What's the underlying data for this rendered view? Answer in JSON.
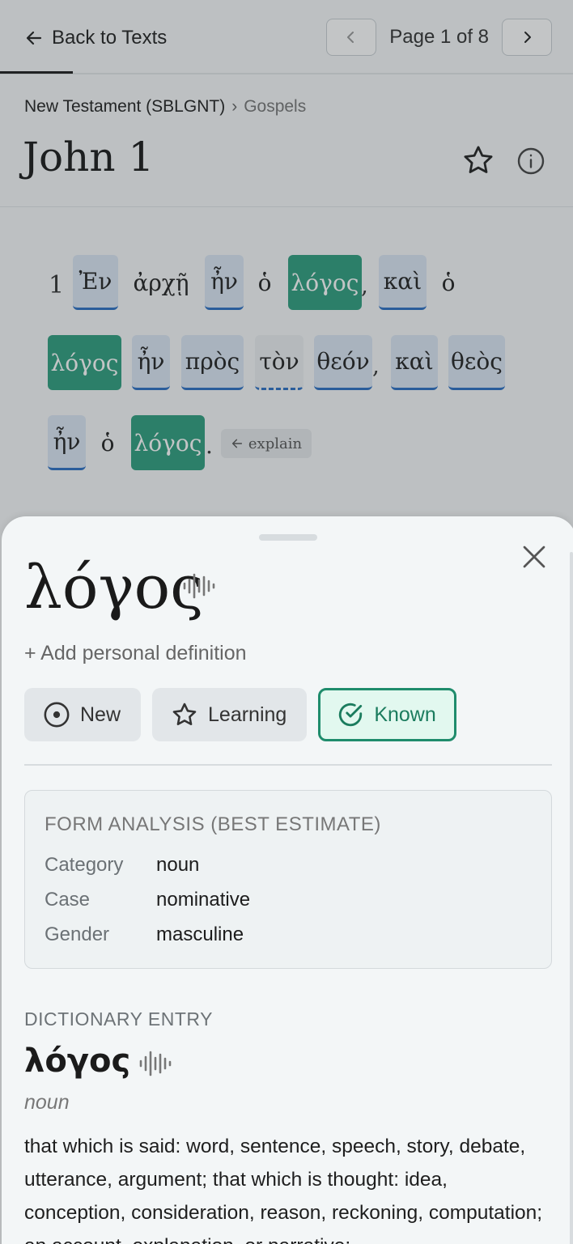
{
  "nav": {
    "back_label": "Back to Texts",
    "page_label": "Page 1 of 8"
  },
  "breadcrumb": {
    "collection": "New Testament (SBLGNT)",
    "separator": "›",
    "section": "Gospels"
  },
  "page_title": "John 1",
  "verse": {
    "number": "1",
    "words": [
      "Ἐν",
      "ἀρχῇ",
      "ἦν",
      "ὁ",
      "λόγος",
      "καὶ",
      "ὁ",
      "λόγος",
      "ἦν",
      "πρὸς",
      "τὸν",
      "θεόν",
      "καὶ",
      "θεὸς",
      "ἦν",
      "ὁ",
      "λόγος"
    ],
    "punctuation": [
      ",",
      ",",
      "."
    ],
    "explain_label": "explain"
  },
  "sheet": {
    "headword": "λόγος",
    "add_definition": "+ Add personal definition",
    "status": {
      "new": "New",
      "learning": "Learning",
      "known": "Known",
      "selected": "known"
    },
    "analysis": {
      "heading": "FORM ANALYSIS (BEST ESTIMATE)",
      "rows": [
        {
          "key": "Category",
          "value": "noun"
        },
        {
          "key": "Case",
          "value": "nominative"
        },
        {
          "key": "Gender",
          "value": "masculine"
        }
      ]
    },
    "dictionary": {
      "heading": "DICTIONARY ENTRY",
      "lemma": "λόγος",
      "part_of_speech": "noun",
      "definition": "that which is said: word, sentence, speech, story, debate, utterance, argument; that which is thought: idea, conception, consideration, reason, reckoning, computation; an account, explanation, or narrative;"
    }
  },
  "colors": {
    "known": "#2f9e7e",
    "learning": "#dbe6f4",
    "underline": "#2c6fc4",
    "known_border": "#1f8c6c"
  },
  "icons": [
    "arrow-left-icon",
    "chevron-left-icon",
    "chevron-right-icon",
    "star-icon",
    "info-icon",
    "close-icon",
    "audio-wave-icon",
    "circle-dot-icon",
    "star-outline-icon",
    "check-circle-icon"
  ]
}
